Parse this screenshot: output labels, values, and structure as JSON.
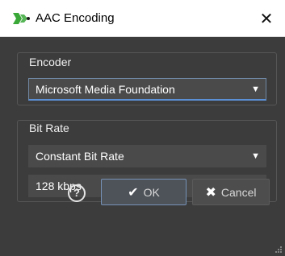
{
  "window": {
    "title": "AAC Encoding",
    "close_glyph": "✕",
    "app_icon": "wavelab-logo-icon"
  },
  "encoder_group": {
    "label": "Encoder",
    "selected": "Microsoft Media Foundation"
  },
  "bitrate_group": {
    "label": "Bit Rate",
    "mode_selected": "Constant Bit Rate",
    "rate_selected": "128 kbps"
  },
  "buttons": {
    "help_glyph": "?",
    "ok_label": "OK",
    "ok_icon": "checkmark-icon",
    "cancel_label": "Cancel",
    "cancel_icon": "x-icon"
  },
  "colors": {
    "titlebar_bg": "#ffffff",
    "client_bg": "#3c3c3c",
    "combo_bg": "#4a4a4a",
    "focus_accent": "#5b8fd6",
    "logo_green": "#3aa839"
  }
}
